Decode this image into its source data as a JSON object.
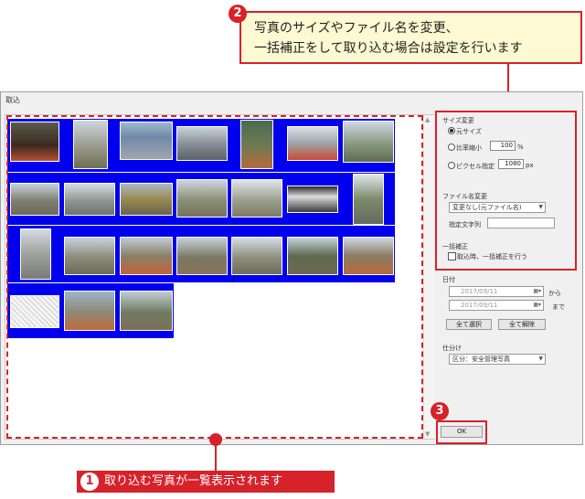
{
  "callouts": {
    "c2": {
      "num": "2",
      "line1": "写真のサイズやファイル名を変更、",
      "line2": "一括補正をして取り込む場合は設定を行います"
    },
    "c1": {
      "num": "1",
      "text": "取り込む写真が一覧表示されます"
    },
    "c3": {
      "num": "3"
    }
  },
  "window": {
    "title": "取込"
  },
  "size": {
    "group": "サイズ変更",
    "opt_original": "元サイズ",
    "opt_ratio": "比率縮小",
    "ratio_value": "100",
    "ratio_unit": "%",
    "opt_pixel": "ピクセル指定",
    "pixel_value": "1080",
    "pixel_unit": "px"
  },
  "filename": {
    "group": "ファイル名変更",
    "mode": "変更なし(元ファイル名)",
    "text_label": "指定文字列",
    "text_value": ""
  },
  "batch": {
    "group": "一括補正",
    "checkbox_label": "取込時、一括補正を行う"
  },
  "date": {
    "group": "日付",
    "from": "2017/09/11",
    "from_suffix": "から",
    "to": "2017/09/11",
    "to_suffix": "まで",
    "select_all": "全て選択",
    "deselect_all": "全て解除"
  },
  "sort": {
    "group": "仕分け",
    "value": "区分：安全管理写真"
  },
  "ok_label": "OK"
}
